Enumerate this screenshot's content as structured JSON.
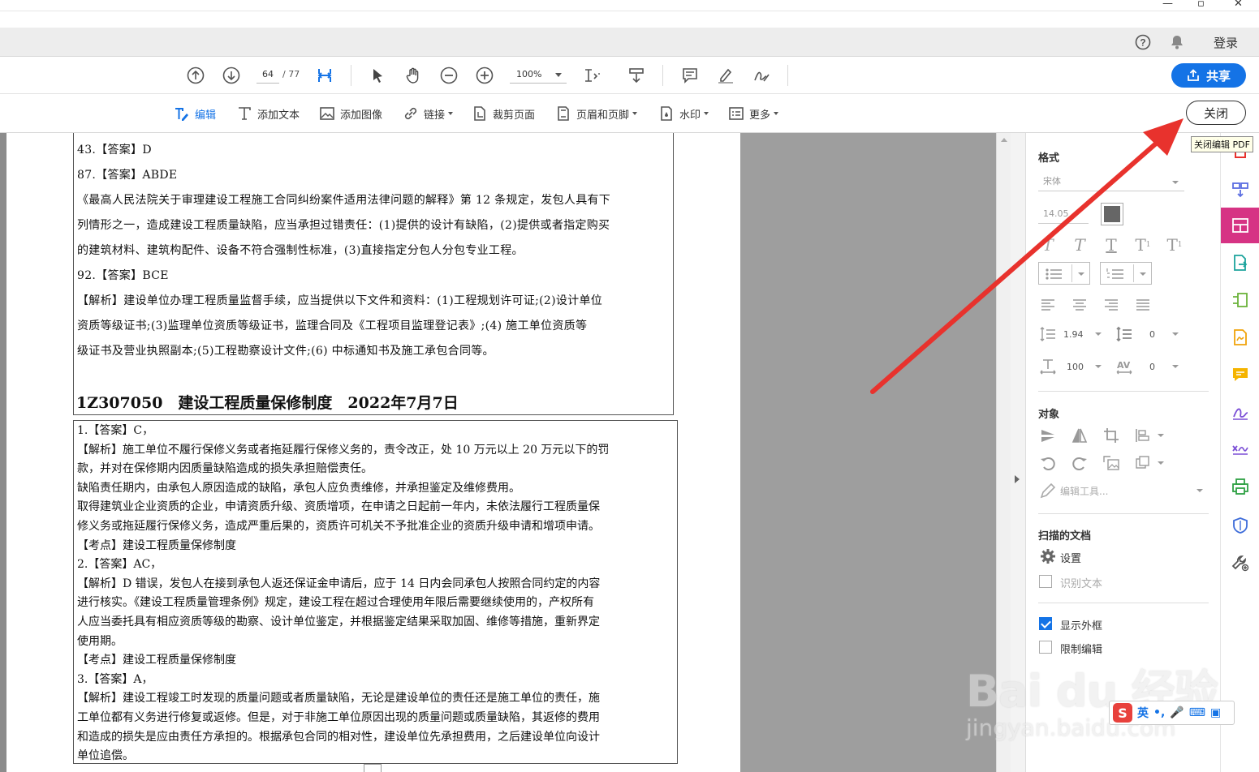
{
  "menubar": {
    "login": "登录"
  },
  "toolbar": {
    "page_current": "64",
    "page_total": "/ 77",
    "zoom": "100%",
    "share": "共享"
  },
  "edit_toolbar": {
    "edit": "编辑",
    "add_text": "添加文本",
    "add_image": "添加图像",
    "link": "链接",
    "crop": "裁剪页面",
    "header_footer": "页眉和页脚",
    "watermark": "水印",
    "more": "更多",
    "close": "关闭",
    "close_tooltip": "关闭编辑 PDF"
  },
  "document": {
    "box1_lines": [
      "43.【答案】D",
      "87.【答案】ABDE",
      "《最高人民法院关于审理建设工程施工合同纠纷案件适用法律问题的解释》第 12 条规定，发包人具有下",
      "列情形之一，造成建设工程质量缺陷，应当承担过错责任：(1)提供的设计有缺陷，(2)提供或者指定购买",
      "的建筑材料、建筑构配件、设备不符合强制性标准，(3)直接指定分包人分包专业工程。",
      "92.【答案】BCE",
      "【解析】建设单位办理工程质量监督手续，应当提供以下文件和资料：(1)工程规划许可证;(2)设计单位",
      "资质等级证书;(3)监理单位资质等级证书，监理合同及《工程项目监理登记表》;(4) 施工单位资质等",
      "级证书及营业执照副本;(5)工程勘察设计文件;(6) 中标通知书及施工承包合同等。"
    ],
    "section_title": "1Z307050　建设工程质量保修制度　2022年7月7日",
    "box2_lines": [
      "1.【答案】C，",
      "【解析】施工单位不履行保修义务或者拖延履行保修义务的，责令改正，处 10 万元以上 20 万元以下的罚",
      "款，并对在保修期内因质量缺陷造成的损失承担赔偿责任。",
      "缺陷责任期内，由承包人原因造成的缺陷，承包人应负责维修，并承担鉴定及维修费用。",
      "取得建筑业企业资质的企业，申请资质升级、资质增项，在申请之日起前一年内，未依法履行工程质量保",
      "修义务或拖延履行保修义务，造成严重后果的，资质许可机关不予批准企业的资质升级申请和增项申请。",
      "【考点】建设工程质量保修制度",
      "2.【答案】AC，",
      "【解析】D 错误，发包人在接到承包人返还保证金申请后，应于 14 日内会同承包人按照合同约定的内容",
      "进行核实。《建设工程质量管理条例》规定，建设工程在超过合理使用年限后需要继续使用的，产权所有",
      "人应当委托具有相应资质等级的勘察、设计单位鉴定，并根据鉴定结果采取加固、维修等措施，重新界定",
      "使用期。",
      "【考点】建设工程质量保修制度",
      "3.【答案】A，",
      "【解析】建设工程竣工时发现的质量问题或者质量缺陷，无论是建设单位的责任还是施工单位的责任，施",
      "工单位都有义务进行修复或返修。但是，对于非施工单位原因出现的质量问题或质量缺陷，其返修的费用",
      "和造成的损失是应由责任方承担的。根据承包合同的相对性，建设单位先承担费用，之后建设单位向设计",
      "单位追偿。"
    ]
  },
  "panel": {
    "format_title": "格式",
    "font": "宋体",
    "font_size": "14.05",
    "line_spacing": "1.94",
    "para_spacing": "0",
    "h_scale": "100",
    "char_spacing": "0",
    "objects_title": "对象",
    "edit_tools": "编辑工具...",
    "scanned_title": "扫描的文档",
    "settings": "设置",
    "recognize_text": "识别文本",
    "show_frame": "显示外框",
    "restrict_edit": "限制编辑"
  },
  "watermark": {
    "brand": "Bai du 经验",
    "url": "jingyan.baidu.com"
  },
  "ime": {
    "lang": "英"
  },
  "colors": {
    "accent": "#1473e6",
    "active_tool": "#d63384",
    "arrow": "#e8322d"
  }
}
